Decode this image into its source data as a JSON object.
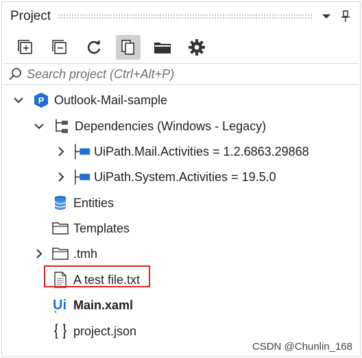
{
  "panel": {
    "title": "Project"
  },
  "toolbar": {
    "buttons": [
      {
        "name": "expand-all-icon"
      },
      {
        "name": "collapse-all-icon"
      },
      {
        "name": "refresh-icon"
      },
      {
        "name": "show-all-files-icon",
        "active": true
      },
      {
        "name": "open-folder-icon"
      },
      {
        "name": "settings-icon"
      }
    ]
  },
  "search": {
    "placeholder": "Search project (Ctrl+Alt+P)",
    "value": ""
  },
  "tree": {
    "root": {
      "label": "Outlook-Mail-sample",
      "icon": "project-icon",
      "expanded": true
    },
    "dependencies": {
      "label": "Dependencies (Windows - Legacy)",
      "icon": "dependencies-icon",
      "expanded": true
    },
    "deps": [
      {
        "label": "UiPath.Mail.Activities = 1.2.6863.29868",
        "icon": "package-icon"
      },
      {
        "label": "UiPath.System.Activities = 19.5.0",
        "icon": "package-icon"
      }
    ],
    "entities": {
      "label": "Entities",
      "icon": "database-icon"
    },
    "templates": {
      "label": "Templates",
      "icon": "folder-icon"
    },
    "tmh": {
      "label": ".tmh",
      "icon": "folder-icon"
    },
    "testfile": {
      "label": "A test file.txt",
      "icon": "text-file-icon",
      "highlighted": true
    },
    "main": {
      "label": "Main.xaml",
      "icon": "xaml-icon"
    },
    "projectjson": {
      "label": "project.json",
      "icon": "json-icon"
    }
  },
  "watermark": "CSDN @Chunlin_168",
  "colors": {
    "accent_blue": "#1c6fd6",
    "highlight_border": "#e02020"
  }
}
